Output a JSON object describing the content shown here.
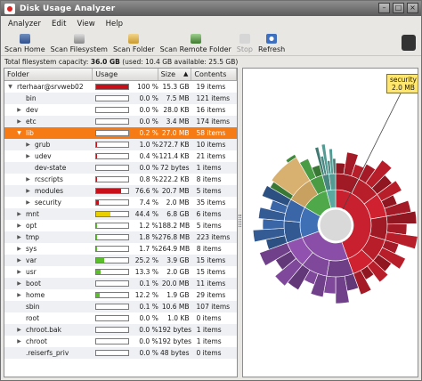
{
  "window": {
    "title": "Disk Usage Analyzer"
  },
  "menu": [
    "Analyzer",
    "Edit",
    "View",
    "Help"
  ],
  "toolbar": {
    "scan_home": "Scan Home",
    "scan_filesystem": "Scan Filesystem",
    "scan_folder": "Scan Folder",
    "scan_remote": "Scan Remote Folder",
    "stop": "Stop",
    "refresh": "Refresh"
  },
  "capacity": {
    "prefix": "Total filesystem capacity:",
    "total": "36.0 GB",
    "detail": "(used: 10.4 GB available: 25.5 GB)"
  },
  "columns": {
    "folder": "Folder",
    "usage": "Usage",
    "size": "Size",
    "contents": "Contents",
    "sort_indicator": "▲"
  },
  "rows": [
    {
      "name": "rterhaar@srvweb02",
      "depth": 0,
      "expander": "expanded",
      "usage": 100,
      "pct": "100 %",
      "size": "15.3 GB",
      "contents": "19 items",
      "color": "#c8101a"
    },
    {
      "name": "bin",
      "depth": 1,
      "expander": "none",
      "usage": 0,
      "pct": "0.0 %",
      "size": "7.5 MB",
      "contents": "121 items",
      "color": "#c8101a"
    },
    {
      "name": "dev",
      "depth": 1,
      "expander": "collapsed",
      "usage": 0,
      "pct": "0.0 %",
      "size": "28.0 KB",
      "contents": "16 items",
      "color": "#c8101a"
    },
    {
      "name": "etc",
      "depth": 1,
      "expander": "collapsed",
      "usage": 0,
      "pct": "0.0 %",
      "size": "3.4 MB",
      "contents": "174 items",
      "color": "#c8101a"
    },
    {
      "name": "lib",
      "depth": 1,
      "expander": "expanded",
      "usage": 0.2,
      "pct": "0.2 %",
      "size": "27.0 MB",
      "contents": "58 items",
      "color": "#c8101a",
      "selected": true
    },
    {
      "name": "grub",
      "depth": 2,
      "expander": "collapsed",
      "usage": 1.0,
      "pct": "1.0 %",
      "size": "272.7 KB",
      "contents": "10 items",
      "color": "#c8101a"
    },
    {
      "name": "udev",
      "depth": 2,
      "expander": "collapsed",
      "usage": 0.4,
      "pct": "0.4 %",
      "size": "121.4 KB",
      "contents": "21 items",
      "color": "#c8101a"
    },
    {
      "name": "dev-state",
      "depth": 2,
      "expander": "none",
      "usage": 0,
      "pct": "0.0 %",
      "size": "72 bytes",
      "contents": "1 items",
      "color": "#c8101a"
    },
    {
      "name": "rcscripts",
      "depth": 2,
      "expander": "collapsed",
      "usage": 0.8,
      "pct": "0.8 %",
      "size": "222.2 KB",
      "contents": "8 items",
      "color": "#c8101a"
    },
    {
      "name": "modules",
      "depth": 2,
      "expander": "collapsed",
      "usage": 76.6,
      "pct": "76.6 %",
      "size": "20.7 MB",
      "contents": "5 items",
      "color": "#c8101a"
    },
    {
      "name": "security",
      "depth": 2,
      "expander": "collapsed",
      "usage": 7.4,
      "pct": "7.4 %",
      "size": "2.0 MB",
      "contents": "35 items",
      "color": "#c8101a"
    },
    {
      "name": "mnt",
      "depth": 1,
      "expander": "collapsed",
      "usage": 44.4,
      "pct": "44.4 %",
      "size": "6.8 GB",
      "contents": "6 items",
      "color": "#e8d000"
    },
    {
      "name": "opt",
      "depth": 1,
      "expander": "collapsed",
      "usage": 1.2,
      "pct": "1.2 %",
      "size": "188.2 MB",
      "contents": "5 items",
      "color": "#5bbf2c"
    },
    {
      "name": "tmp",
      "depth": 1,
      "expander": "collapsed",
      "usage": 1.8,
      "pct": "1.8 %",
      "size": "276.8 MB",
      "contents": "223 items",
      "color": "#5bbf2c"
    },
    {
      "name": "sys",
      "depth": 1,
      "expander": "collapsed",
      "usage": 1.7,
      "pct": "1.7 %",
      "size": "264.9 MB",
      "contents": "8 items",
      "color": "#5bbf2c"
    },
    {
      "name": "var",
      "depth": 1,
      "expander": "collapsed",
      "usage": 25.2,
      "pct": "25.2 %",
      "size": "3.9 GB",
      "contents": "15 items",
      "color": "#5bbf2c"
    },
    {
      "name": "usr",
      "depth": 1,
      "expander": "collapsed",
      "usage": 13.3,
      "pct": "13.3 %",
      "size": "2.0 GB",
      "contents": "15 items",
      "color": "#5bbf2c"
    },
    {
      "name": "boot",
      "depth": 1,
      "expander": "collapsed",
      "usage": 0.1,
      "pct": "0.1 %",
      "size": "20.0 MB",
      "contents": "11 items",
      "color": "#5bbf2c"
    },
    {
      "name": "home",
      "depth": 1,
      "expander": "collapsed",
      "usage": 12.2,
      "pct": "12.2 %",
      "size": "1.9 GB",
      "contents": "29 items",
      "color": "#5bbf2c"
    },
    {
      "name": "sbin",
      "depth": 1,
      "expander": "none",
      "usage": 0,
      "pct": "0.1 %",
      "size": "10.6 MB",
      "contents": "107 items",
      "color": "#5bbf2c"
    },
    {
      "name": "root",
      "depth": 1,
      "expander": "none",
      "usage": 0,
      "pct": "0.0 %",
      "size": "1.0 KB",
      "contents": "0 items",
      "color": "#5bbf2c"
    },
    {
      "name": "chroot.bak",
      "depth": 1,
      "expander": "collapsed",
      "usage": 0,
      "pct": "0.0 %",
      "size": "192 bytes",
      "contents": "1 items",
      "color": "#5bbf2c"
    },
    {
      "name": "chroot",
      "depth": 1,
      "expander": "collapsed",
      "usage": 0,
      "pct": "0.0 %",
      "size": "192 bytes",
      "contents": "1 items",
      "color": "#5bbf2c"
    },
    {
      "name": ".reiserfs_priv",
      "depth": 1,
      "expander": "none",
      "usage": 0,
      "pct": "0.0 %",
      "size": "48 bytes",
      "contents": "0 items",
      "color": "#5bbf2c"
    }
  ],
  "ringchart": {
    "tooltip_name": "security",
    "tooltip_size": "2.0 MB",
    "colors": [
      "#c8202e",
      "#8a4ea8",
      "#3f6fb5",
      "#4fa84a",
      "#d4a23a",
      "#5aa8a0"
    ]
  }
}
